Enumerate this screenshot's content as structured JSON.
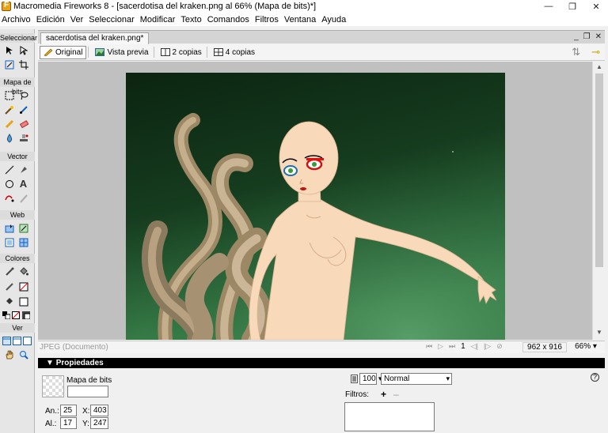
{
  "window": {
    "title": "Macromedia Fireworks 8 - [sacerdotisa del kraken.png al  66% (Mapa de bits)*]",
    "minimize": "—",
    "maximize": "❐",
    "close": "✕"
  },
  "menu": [
    "Archivo",
    "Edición",
    "Ver",
    "Seleccionar",
    "Modificar",
    "Texto",
    "Comandos",
    "Filtros",
    "Ventana",
    "Ayuda"
  ],
  "toolbox": {
    "sections": [
      "Seleccionar",
      "Mapa de bits",
      "Vector",
      "Web",
      "Colores",
      "Ver"
    ],
    "icons": {
      "pointer": "pointer-icon",
      "subselect": "subselection-icon",
      "scale": "scale-icon",
      "crop": "crop-icon",
      "marquee": "marquee-icon",
      "lasso": "lasso-icon",
      "magic_wand": "magic-wand-icon",
      "brush": "brush-icon",
      "pencil": "pencil-icon",
      "eraser": "eraser-icon",
      "blur": "blur-icon",
      "stamp": "rubber-stamp-icon",
      "line": "line-icon",
      "pen": "pen-icon",
      "ellipse": "ellipse-icon",
      "text": "text-tool-icon",
      "freeform": "freeform-icon",
      "knife": "knife-icon",
      "hotspot": "hotspot-icon",
      "slice": "slice-icon",
      "eyedropper": "eyedropper-icon",
      "paint_bucket": "paint-bucket-icon",
      "hand": "hand-icon",
      "zoom": "zoom-icon"
    }
  },
  "document": {
    "tab_label": "sacerdotisa del kraken.png*",
    "window_controls": [
      "_",
      "❐",
      "✕"
    ],
    "views": [
      "Original",
      "Vista previa",
      "2 copias",
      "4 copias"
    ],
    "active_view": "Original"
  },
  "statusbar": {
    "type_text": "JPEG (Documento)",
    "frame": "1",
    "size": "962 x 916",
    "zoom": "66%"
  },
  "properties": {
    "title": "Propiedades",
    "object_name": "Mapa de bits",
    "labels": {
      "w": "An.:",
      "h": "Al.:",
      "x": "X:",
      "y": "Y:",
      "filters": "Filtros:"
    },
    "values": {
      "w": "25",
      "h": "17",
      "x": "403",
      "y": "247"
    },
    "opacity": "100",
    "blend_mode": "Normal",
    "add_filter": "+",
    "remove_filter": "–",
    "help": "?"
  },
  "colors": {
    "canvas_bg": "#c0c0c0",
    "art_bg_dark": "#0e2a12",
    "art_bg_light": "#3f8a4e",
    "skin": "#f6d7b8",
    "tentacle": "#a89070"
  }
}
